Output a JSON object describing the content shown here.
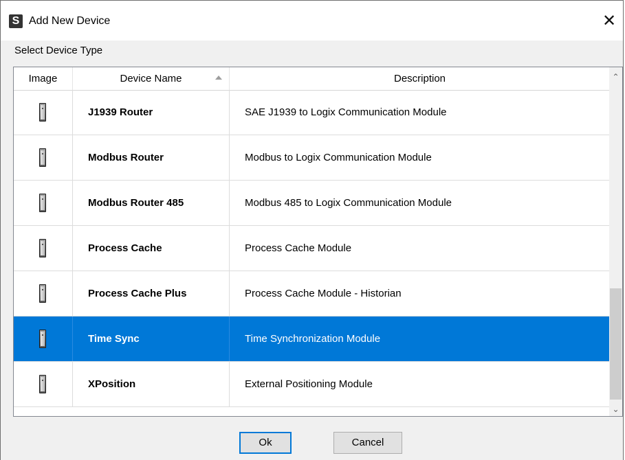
{
  "window": {
    "title": "Add New Device",
    "app_icon_letter": "S",
    "close_glyph": "✕"
  },
  "section_label": "Select Device Type",
  "table": {
    "columns": [
      "Image",
      "Device Name",
      "Description"
    ],
    "sorted_column": "Device Name",
    "sort_direction": "ascending",
    "rows": [
      {
        "name": "J1939 Router",
        "description": "SAE J1939 to Logix Communication Module",
        "icon": "device-module-icon",
        "selected": false
      },
      {
        "name": "Modbus Router",
        "description": "Modbus to Logix Communication Module",
        "icon": "device-module-icon",
        "selected": false
      },
      {
        "name": "Modbus Router 485",
        "description": "Modbus 485 to Logix Communication Module",
        "icon": "device-module-icon",
        "selected": false
      },
      {
        "name": "Process Cache",
        "description": "Process Cache Module",
        "icon": "device-module-icon",
        "selected": false
      },
      {
        "name": "Process Cache Plus",
        "description": "Process Cache Module - Historian",
        "icon": "device-module-icon",
        "selected": false
      },
      {
        "name": "Time Sync",
        "description": "Time Synchronization Module",
        "icon": "device-module-icon",
        "selected": true
      },
      {
        "name": "XPosition",
        "description": "External Positioning Module",
        "icon": "device-module-icon",
        "selected": false
      }
    ]
  },
  "buttons": {
    "ok": "Ok",
    "cancel": "Cancel"
  },
  "colors": {
    "selection": "#0078d7",
    "default_button_border": "#0078d7"
  }
}
